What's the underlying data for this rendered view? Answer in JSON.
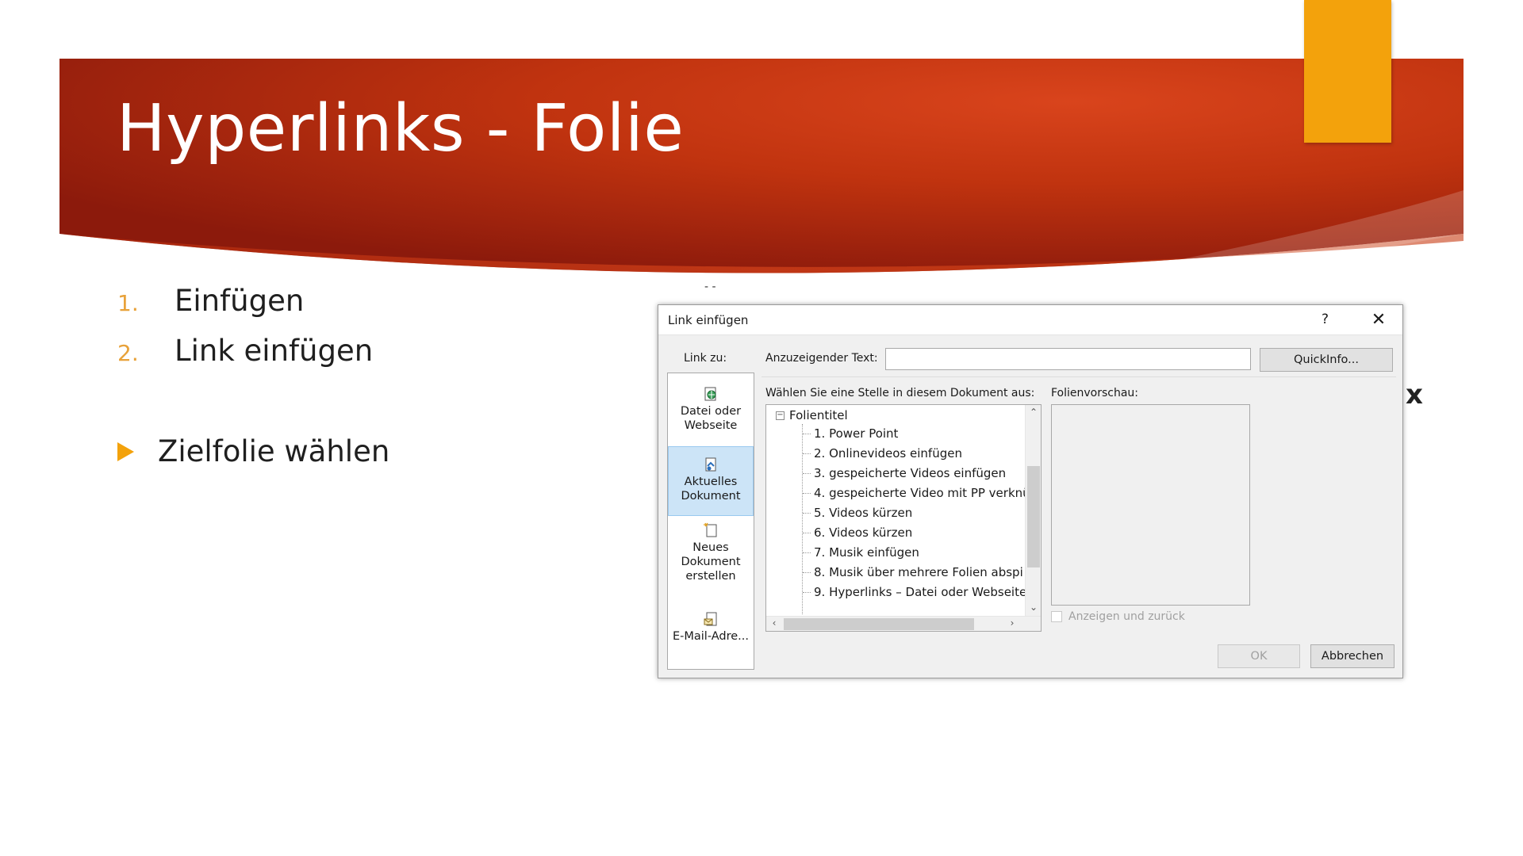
{
  "slide": {
    "title": "Hyperlinks - Folie",
    "numbered_items": [
      {
        "num": "1.",
        "text": "Einfügen"
      },
      {
        "num": "2.",
        "text": "Link einfügen"
      }
    ],
    "bullet": "Zielfolie wählen",
    "colors": {
      "banner_dark": "#8c1a0c",
      "banner_light": "#d9441c",
      "accent": "#f3a20c",
      "number": "#e8a23a"
    }
  },
  "dialog": {
    "title": "Link einfügen",
    "help": "?",
    "close": "✕",
    "link_to_label": "Link zu:",
    "link_to_items": [
      {
        "label": "Datei oder Webseite",
        "icon": "file-web-icon",
        "active": false
      },
      {
        "label": "Aktuelles Dokument",
        "icon": "current-document-icon",
        "active": true
      },
      {
        "label": "Neues Dokument erstellen",
        "icon": "new-document-icon",
        "active": false
      },
      {
        "label": "E-Mail-Adre...",
        "icon": "email-icon",
        "active": false
      }
    ],
    "display_text_label": "Anzuzeigender Text:",
    "display_text_value": "",
    "quickinfo_label": "QuickInfo...",
    "place_label": "Wählen Sie eine Stelle in diesem Dokument aus:",
    "tree_root": "Folientitel",
    "tree_items": [
      "1. Power Point",
      "2. Onlinevideos einfügen",
      "3. gespeicherte Videos einfügen",
      "4. gespeicherte Video mit PP verknü",
      "5. Videos kürzen",
      "6. Videos kürzen",
      "7. Musik einfügen",
      "8. Musik über mehrere Folien abspi",
      "9. Hyperlinks – Datei oder Webseite"
    ],
    "preview_label": "Folienvorschau:",
    "show_and_return_label": "Anzeigen und zurück",
    "ok_label": "OK",
    "cancel_label": "Abbrechen"
  }
}
